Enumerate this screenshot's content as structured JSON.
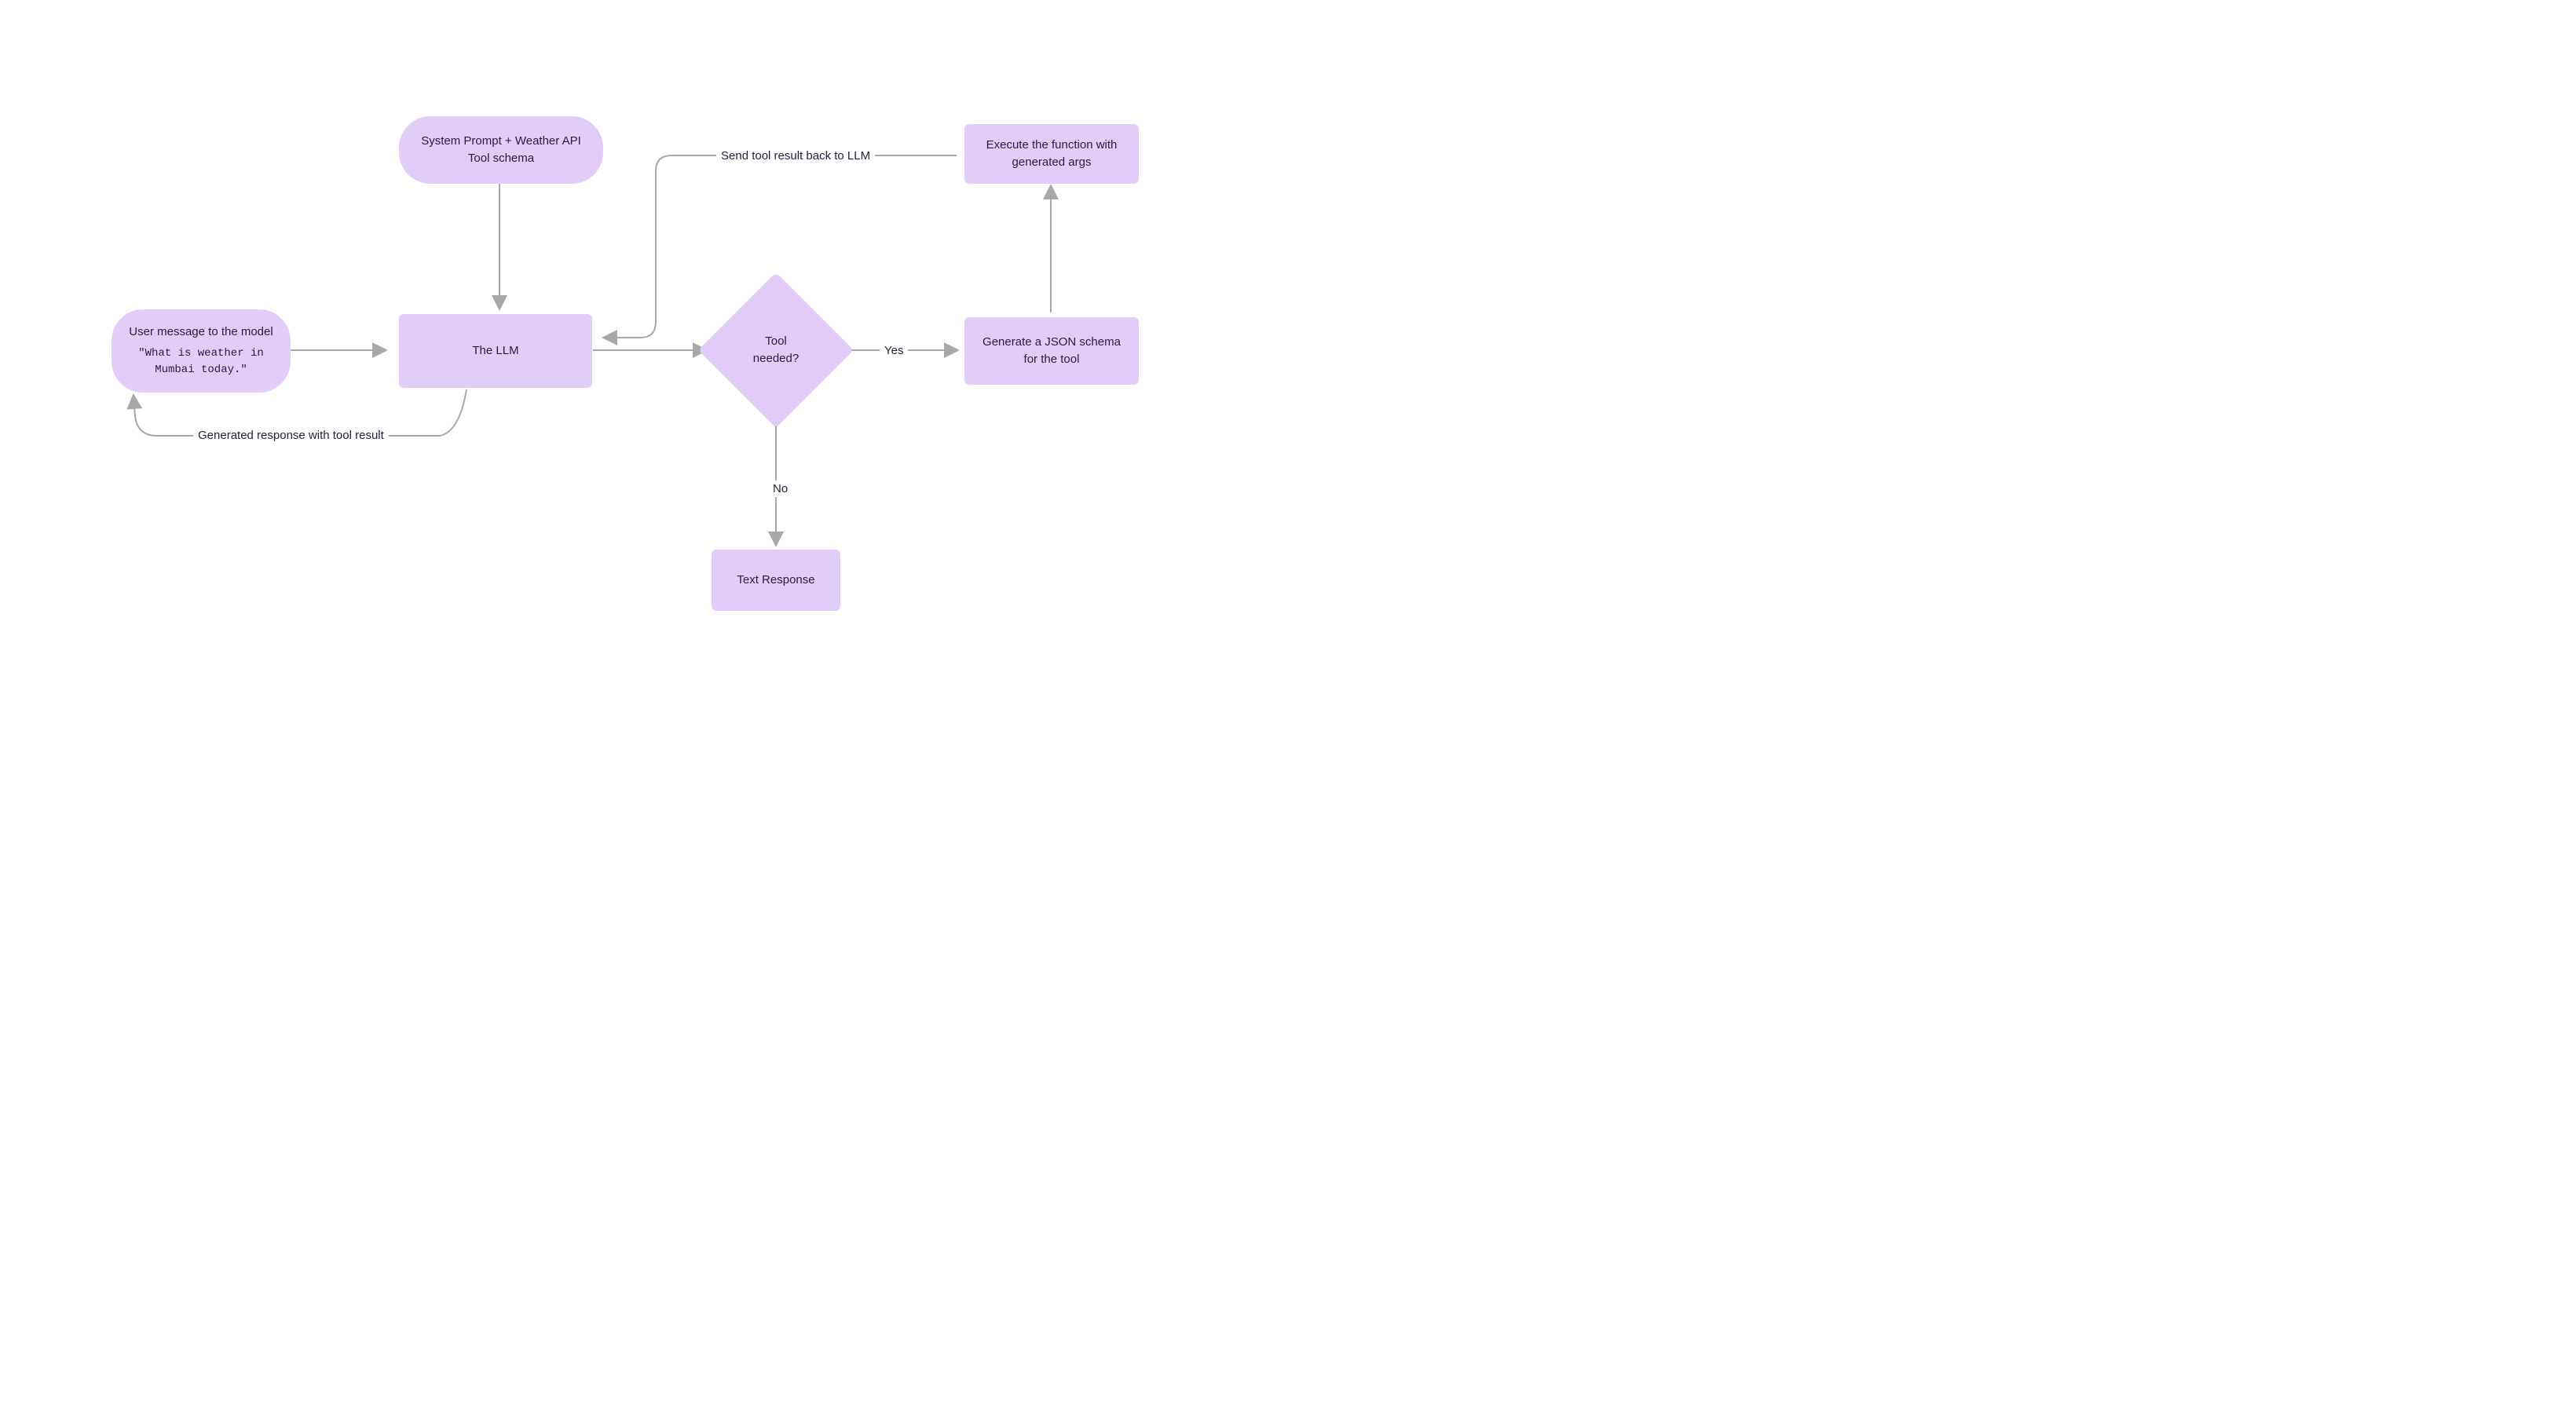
{
  "nodes": {
    "user_message": {
      "title": "User message to the model",
      "subtitle": "\"What is weather in Mumbai today.\""
    },
    "system_prompt": {
      "text": "System Prompt + Weather API Tool schema"
    },
    "llm": {
      "text": "The LLM"
    },
    "decision": {
      "text": "Tool needed?"
    },
    "generate_json": {
      "text": "Generate a JSON schema for the tool"
    },
    "execute_fn": {
      "text": "Execute the function with generated args"
    },
    "text_response": {
      "text": "Text Response"
    }
  },
  "edges": {
    "yes": "Yes",
    "no": "No",
    "send_back": "Send tool result back to LLM",
    "generated_response": "Generated response with tool result"
  },
  "colors": {
    "node_fill": "#e1cdf7",
    "arrow": "#a8a8a8",
    "text": "#2a1b3d"
  }
}
